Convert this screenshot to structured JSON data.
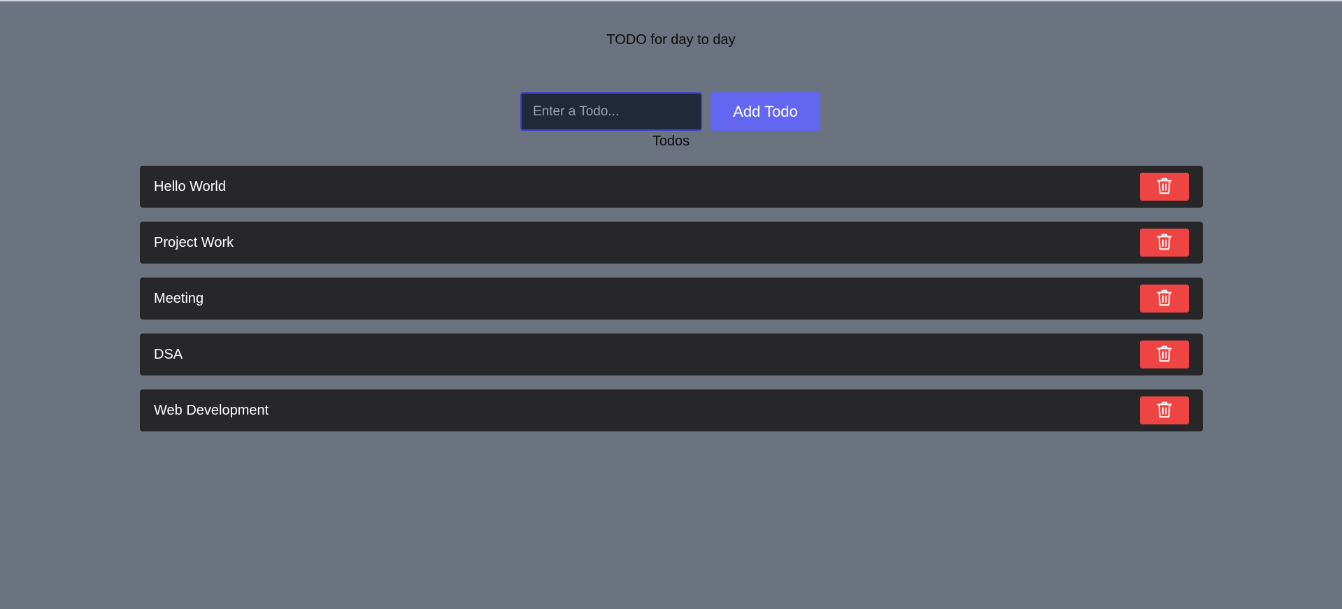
{
  "app": {
    "title": "TODO for day to day"
  },
  "form": {
    "input_value": "",
    "input_placeholder": "Enter a Todo...",
    "add_label": "Add Todo"
  },
  "list": {
    "heading": "Todos",
    "items": [
      {
        "text": "Hello World",
        "action_icon": "trash-icon"
      },
      {
        "text": "Project Work",
        "action_icon": "trash-icon"
      },
      {
        "text": "Meeting",
        "action_icon": "trash-icon"
      },
      {
        "text": "DSA",
        "action_icon": "trash-icon"
      },
      {
        "text": "Web Development",
        "action_icon": "trash-icon"
      }
    ]
  },
  "colors": {
    "background": "#6b7280",
    "accent": "#6366f1",
    "item_background": "#27272a",
    "danger": "#ef4444",
    "input_background": "#1f2937"
  }
}
